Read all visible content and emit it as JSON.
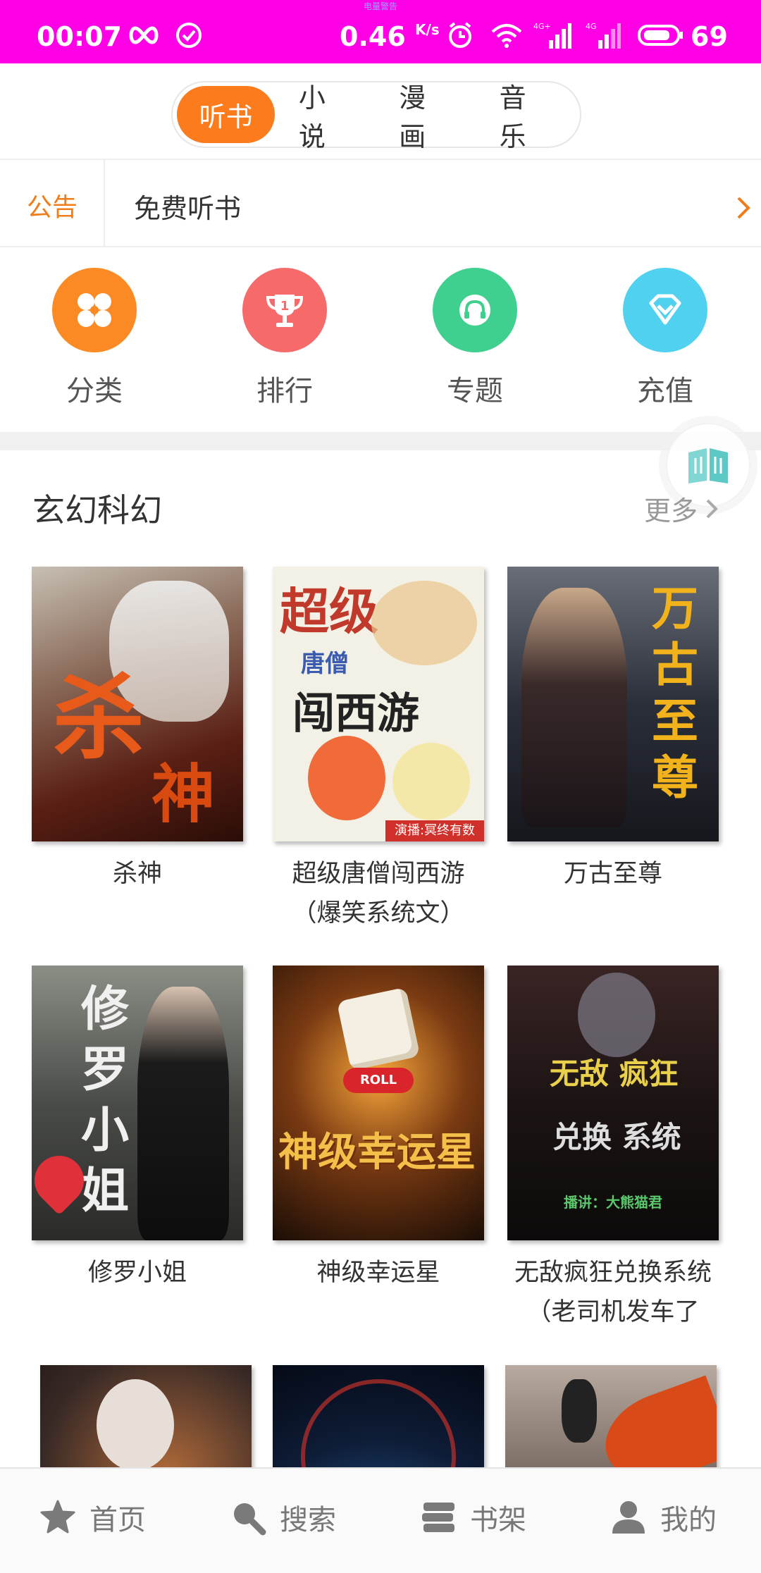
{
  "status_bar": {
    "time": "00:07",
    "speed": "0.46",
    "speed_unit": "K/s",
    "battery": "69",
    "tiny_text": "电量警告"
  },
  "tabs": [
    {
      "label": "听书",
      "active": true
    },
    {
      "label": "小说",
      "active": false
    },
    {
      "label": "漫画",
      "active": false
    },
    {
      "label": "音乐",
      "active": false
    }
  ],
  "notice": {
    "label": "公告",
    "text": "免费听书"
  },
  "quick_menu": [
    {
      "label": "分类",
      "icon": "clover-icon",
      "color": "#fb8a25"
    },
    {
      "label": "排行",
      "icon": "trophy-icon",
      "color": "#f66a6a"
    },
    {
      "label": "专题",
      "icon": "headphones-icon",
      "color": "#3fcf8e"
    },
    {
      "label": "充值",
      "icon": "diamond-icon",
      "color": "#4fd1ef"
    }
  ],
  "section": {
    "title": "玄幻科幻",
    "more": "更多"
  },
  "books": [
    {
      "title": "杀神",
      "cover_text": "杀神",
      "bg": "#5a1f14",
      "accent": "#e85a1a"
    },
    {
      "title": "超级唐僧闯西游（爆笑系统文）",
      "cover_text": "超级",
      "bg": "#f3f0e6",
      "accent": "#c0392b"
    },
    {
      "title": "万古至尊",
      "cover_text": "万古至尊",
      "bg": "#2b2f3a",
      "accent": "#f2b21b"
    },
    {
      "title": "修罗小姐",
      "cover_text": "修罗小姐",
      "bg": "#3d3f3b",
      "accent": "#e8e8e8"
    },
    {
      "title": "神级幸运星",
      "cover_text": "神级幸运星",
      "bg": "#2a1a10",
      "accent": "#f5b638"
    },
    {
      "title": "无敌疯狂兑换系统（老司机发车了",
      "cover_text": "无敌疯狂",
      "bg": "#1c1414",
      "accent": "#e8d04a"
    },
    {
      "title": "",
      "cover_text": "",
      "bg": "#3a2a26",
      "accent": "#ff9a3a"
    },
    {
      "title": "",
      "cover_text": "",
      "bg": "#0e1c36",
      "accent": "#3d8bd8"
    },
    {
      "title": "",
      "cover_text": "",
      "bg": "#5a4b45",
      "accent": "#f6b630"
    }
  ],
  "bottom_nav": [
    {
      "label": "首页",
      "icon": "star-icon"
    },
    {
      "label": "搜索",
      "icon": "search-icon"
    },
    {
      "label": "书架",
      "icon": "bookshelf-icon"
    },
    {
      "label": "我的",
      "icon": "user-icon"
    }
  ]
}
